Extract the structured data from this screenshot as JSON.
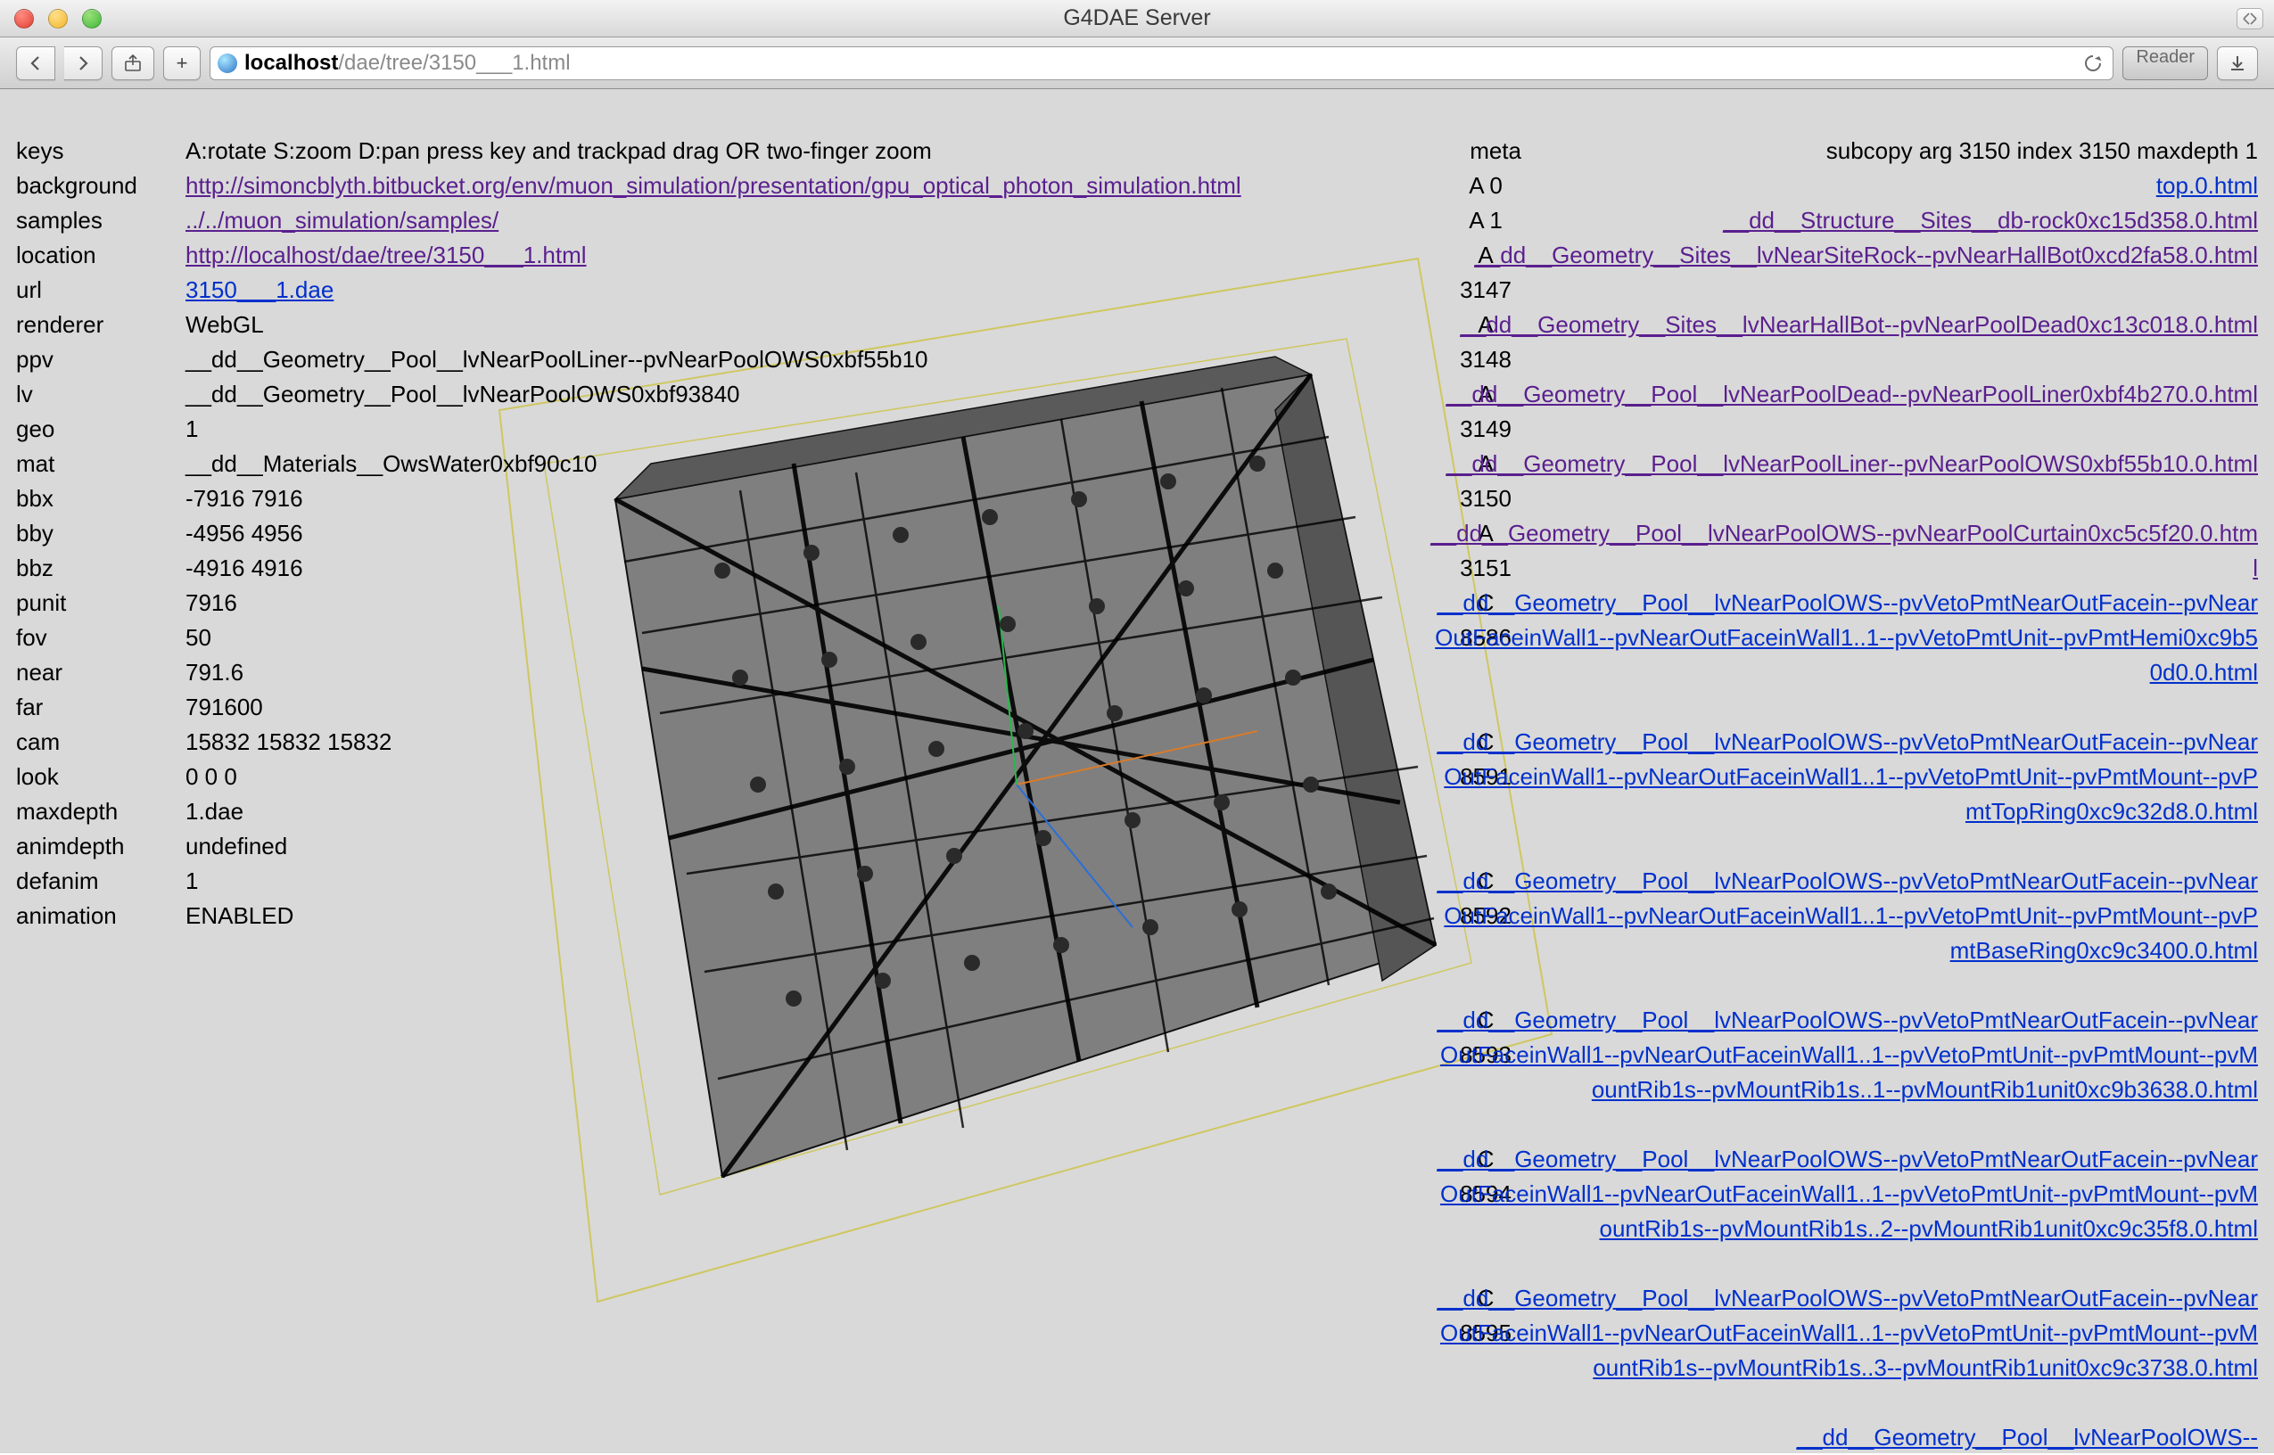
{
  "window": {
    "title": "G4DAE Server"
  },
  "url": {
    "host": "localhost",
    "path": "/dae/tree/3150___1.html"
  },
  "toolbar": {
    "reader": "Reader",
    "add": "+"
  },
  "left": [
    {
      "k": "keys",
      "v": "A:rotate S:zoom D:pan press key and trackpad drag OR two-finger zoom",
      "link": false
    },
    {
      "k": "background",
      "v": "http://simoncblyth.bitbucket.org/env/muon_simulation/presentation/gpu_optical_photon_simulation.html",
      "link": true,
      "visited": true
    },
    {
      "k": "samples",
      "v": "../../muon_simulation/samples/",
      "link": true,
      "visited": true
    },
    {
      "k": "location",
      "v": "http://localhost/dae/tree/3150___1.html",
      "link": true,
      "visited": true
    },
    {
      "k": "url",
      "v": "3150___1.dae",
      "link": true,
      "visited": false
    },
    {
      "k": "renderer",
      "v": "WebGL",
      "link": false
    },
    {
      "k": "ppv",
      "v": "__dd__Geometry__Pool__lvNearPoolLiner--pvNearPoolOWS0xbf55b10",
      "link": false
    },
    {
      "k": "lv",
      "v": "__dd__Geometry__Pool__lvNearPoolOWS0xbf93840",
      "link": false
    },
    {
      "k": "geo",
      "v": "1",
      "link": false
    },
    {
      "k": "mat",
      "v": "__dd__Materials__OwsWater0xbf90c10",
      "link": false
    },
    {
      "k": "bbx",
      "v": "-7916 7916",
      "link": false
    },
    {
      "k": "bby",
      "v": "-4956 4956",
      "link": false
    },
    {
      "k": "bbz",
      "v": "-4916 4916",
      "link": false
    },
    {
      "k": "punit",
      "v": "7916",
      "link": false
    },
    {
      "k": "fov",
      "v": "50",
      "link": false
    },
    {
      "k": "near",
      "v": "791.6",
      "link": false
    },
    {
      "k": "far",
      "v": "791600",
      "link": false
    },
    {
      "k": "cam",
      "v": "15832 15832 15832",
      "link": false
    },
    {
      "k": "look",
      "v": "0 0 0",
      "link": false
    },
    {
      "k": "maxdepth",
      "v": "1.dae",
      "link": false
    },
    {
      "k": "animdepth",
      "v": "undefined",
      "link": false
    },
    {
      "k": "defanim",
      "v": "1",
      "link": false
    },
    {
      "k": "animation",
      "v": "ENABLED",
      "link": false
    }
  ],
  "meta": {
    "header": "meta",
    "rows": [
      {
        "t": "A 0"
      },
      {
        "t": "A 1"
      },
      {
        "t": "A 3147"
      },
      {
        "t": "A 3148"
      },
      {
        "t": "A 3149"
      },
      {
        "t": "A 3150"
      },
      {
        "t": "A 3151"
      },
      {
        "t": "C 8586"
      },
      {
        "t": "C 8591"
      },
      {
        "t": "C 8592"
      },
      {
        "t": "C 8593"
      },
      {
        "t": "C 8594"
      },
      {
        "t": "C 8595"
      }
    ]
  },
  "right": {
    "top": "subcopy arg 3150 index 3150 maxdepth 1",
    "links": [
      {
        "t": "top.0.html",
        "lines": 1,
        "visited": false
      },
      {
        "t": "__dd__Structure__Sites__db-rock0xc15d358.0.html",
        "lines": 1,
        "visited": true
      },
      {
        "t": "__dd__Geometry__Sites__lvNearSiteRock--pvNearHallBot0xcd2fa58.0.html",
        "lines": 2,
        "visited": true
      },
      {
        "t": "__dd__Geometry__Sites__lvNearHallBot--pvNearPoolDead0xc13c018.0.html",
        "lines": 2,
        "visited": true
      },
      {
        "t": "__dd__Geometry__Pool__lvNearPoolDead--pvNearPoolLiner0xbf4b270.0.html",
        "lines": 2,
        "visited": true
      },
      {
        "t": "__dd__Geometry__Pool__lvNearPoolLiner--pvNearPoolOWS0xbf55b10.0.html",
        "lines": 2,
        "visited": true
      },
      {
        "t": "__dd__Geometry__Pool__lvNearPoolOWS--pvNearPoolCurtain0xc5c5f20.0.html",
        "lines": 2,
        "visited": true
      },
      {
        "t": "__dd__Geometry__Pool__lvNearPoolOWS--pvVetoPmtNearOutFacein--pvNearOutFaceinWall1--pvNearOutFaceinWall1..1--pvVetoPmtUnit--pvPmtHemi0xc9b50d0.0.html",
        "lines": 4,
        "visited": false
      },
      {
        "t": "__dd__Geometry__Pool__lvNearPoolOWS--pvVetoPmtNearOutFacein--pvNearOutFaceinWall1--pvNearOutFaceinWall1..1--pvVetoPmtUnit--pvPmtMount--pvPmtTopRing0xc9c32d8.0.html",
        "lines": 4,
        "visited": false
      },
      {
        "t": "__dd__Geometry__Pool__lvNearPoolOWS--pvVetoPmtNearOutFacein--pvNearOutFaceinWall1--pvNearOutFaceinWall1..1--pvVetoPmtUnit--pvPmtMount--pvPmtBaseRing0xc9c3400.0.html",
        "lines": 4,
        "visited": false
      },
      {
        "t": "__dd__Geometry__Pool__lvNearPoolOWS--pvVetoPmtNearOutFacein--pvNearOutFaceinWall1--pvNearOutFaceinWall1..1--pvVetoPmtUnit--pvPmtMount--pvMountRib1s--pvMountRib1s..1--pvMountRib1unit0xc9b3638.0.html",
        "lines": 4,
        "visited": false
      },
      {
        "t": "__dd__Geometry__Pool__lvNearPoolOWS--pvVetoPmtNearOutFacein--pvNearOutFaceinWall1--pvNearOutFaceinWall1..1--pvVetoPmtUnit--pvPmtMount--pvMountRib1s--pvMountRib1s..2--pvMountRib1unit0xc9c35f8.0.html",
        "lines": 4,
        "visited": false
      },
      {
        "t": "__dd__Geometry__Pool__lvNearPoolOWS--pvVetoPmtNearOutFacein--pvNearOutFaceinWall1--pvNearOutFaceinWall1..1--pvVetoPmtUnit--pvPmtMount--pvMountRib1s--pvMountRib1s..3--pvMountRib1unit0xc9c3738.0.html",
        "lines": 4,
        "visited": false
      },
      {
        "t": "__dd__Geometry__Pool__lvNearPoolOWS--",
        "lines": 1,
        "visited": false
      }
    ]
  }
}
